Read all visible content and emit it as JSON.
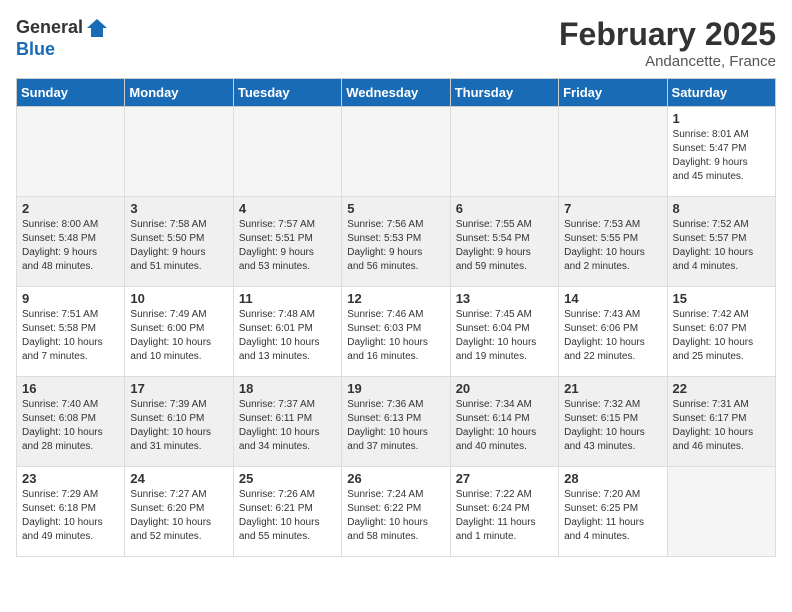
{
  "logo": {
    "general": "General",
    "blue": "Blue"
  },
  "title": {
    "month_year": "February 2025",
    "location": "Andancette, France"
  },
  "headers": [
    "Sunday",
    "Monday",
    "Tuesday",
    "Wednesday",
    "Thursday",
    "Friday",
    "Saturday"
  ],
  "weeks": [
    {
      "shaded": false,
      "days": [
        {
          "num": "",
          "info": ""
        },
        {
          "num": "",
          "info": ""
        },
        {
          "num": "",
          "info": ""
        },
        {
          "num": "",
          "info": ""
        },
        {
          "num": "",
          "info": ""
        },
        {
          "num": "",
          "info": ""
        },
        {
          "num": "1",
          "info": "Sunrise: 8:01 AM\nSunset: 5:47 PM\nDaylight: 9 hours\nand 45 minutes."
        }
      ]
    },
    {
      "shaded": true,
      "days": [
        {
          "num": "2",
          "info": "Sunrise: 8:00 AM\nSunset: 5:48 PM\nDaylight: 9 hours\nand 48 minutes."
        },
        {
          "num": "3",
          "info": "Sunrise: 7:58 AM\nSunset: 5:50 PM\nDaylight: 9 hours\nand 51 minutes."
        },
        {
          "num": "4",
          "info": "Sunrise: 7:57 AM\nSunset: 5:51 PM\nDaylight: 9 hours\nand 53 minutes."
        },
        {
          "num": "5",
          "info": "Sunrise: 7:56 AM\nSunset: 5:53 PM\nDaylight: 9 hours\nand 56 minutes."
        },
        {
          "num": "6",
          "info": "Sunrise: 7:55 AM\nSunset: 5:54 PM\nDaylight: 9 hours\nand 59 minutes."
        },
        {
          "num": "7",
          "info": "Sunrise: 7:53 AM\nSunset: 5:55 PM\nDaylight: 10 hours\nand 2 minutes."
        },
        {
          "num": "8",
          "info": "Sunrise: 7:52 AM\nSunset: 5:57 PM\nDaylight: 10 hours\nand 4 minutes."
        }
      ]
    },
    {
      "shaded": false,
      "days": [
        {
          "num": "9",
          "info": "Sunrise: 7:51 AM\nSunset: 5:58 PM\nDaylight: 10 hours\nand 7 minutes."
        },
        {
          "num": "10",
          "info": "Sunrise: 7:49 AM\nSunset: 6:00 PM\nDaylight: 10 hours\nand 10 minutes."
        },
        {
          "num": "11",
          "info": "Sunrise: 7:48 AM\nSunset: 6:01 PM\nDaylight: 10 hours\nand 13 minutes."
        },
        {
          "num": "12",
          "info": "Sunrise: 7:46 AM\nSunset: 6:03 PM\nDaylight: 10 hours\nand 16 minutes."
        },
        {
          "num": "13",
          "info": "Sunrise: 7:45 AM\nSunset: 6:04 PM\nDaylight: 10 hours\nand 19 minutes."
        },
        {
          "num": "14",
          "info": "Sunrise: 7:43 AM\nSunset: 6:06 PM\nDaylight: 10 hours\nand 22 minutes."
        },
        {
          "num": "15",
          "info": "Sunrise: 7:42 AM\nSunset: 6:07 PM\nDaylight: 10 hours\nand 25 minutes."
        }
      ]
    },
    {
      "shaded": true,
      "days": [
        {
          "num": "16",
          "info": "Sunrise: 7:40 AM\nSunset: 6:08 PM\nDaylight: 10 hours\nand 28 minutes."
        },
        {
          "num": "17",
          "info": "Sunrise: 7:39 AM\nSunset: 6:10 PM\nDaylight: 10 hours\nand 31 minutes."
        },
        {
          "num": "18",
          "info": "Sunrise: 7:37 AM\nSunset: 6:11 PM\nDaylight: 10 hours\nand 34 minutes."
        },
        {
          "num": "19",
          "info": "Sunrise: 7:36 AM\nSunset: 6:13 PM\nDaylight: 10 hours\nand 37 minutes."
        },
        {
          "num": "20",
          "info": "Sunrise: 7:34 AM\nSunset: 6:14 PM\nDaylight: 10 hours\nand 40 minutes."
        },
        {
          "num": "21",
          "info": "Sunrise: 7:32 AM\nSunset: 6:15 PM\nDaylight: 10 hours\nand 43 minutes."
        },
        {
          "num": "22",
          "info": "Sunrise: 7:31 AM\nSunset: 6:17 PM\nDaylight: 10 hours\nand 46 minutes."
        }
      ]
    },
    {
      "shaded": false,
      "days": [
        {
          "num": "23",
          "info": "Sunrise: 7:29 AM\nSunset: 6:18 PM\nDaylight: 10 hours\nand 49 minutes."
        },
        {
          "num": "24",
          "info": "Sunrise: 7:27 AM\nSunset: 6:20 PM\nDaylight: 10 hours\nand 52 minutes."
        },
        {
          "num": "25",
          "info": "Sunrise: 7:26 AM\nSunset: 6:21 PM\nDaylight: 10 hours\nand 55 minutes."
        },
        {
          "num": "26",
          "info": "Sunrise: 7:24 AM\nSunset: 6:22 PM\nDaylight: 10 hours\nand 58 minutes."
        },
        {
          "num": "27",
          "info": "Sunrise: 7:22 AM\nSunset: 6:24 PM\nDaylight: 11 hours\nand 1 minute."
        },
        {
          "num": "28",
          "info": "Sunrise: 7:20 AM\nSunset: 6:25 PM\nDaylight: 11 hours\nand 4 minutes."
        },
        {
          "num": "",
          "info": ""
        }
      ]
    }
  ]
}
